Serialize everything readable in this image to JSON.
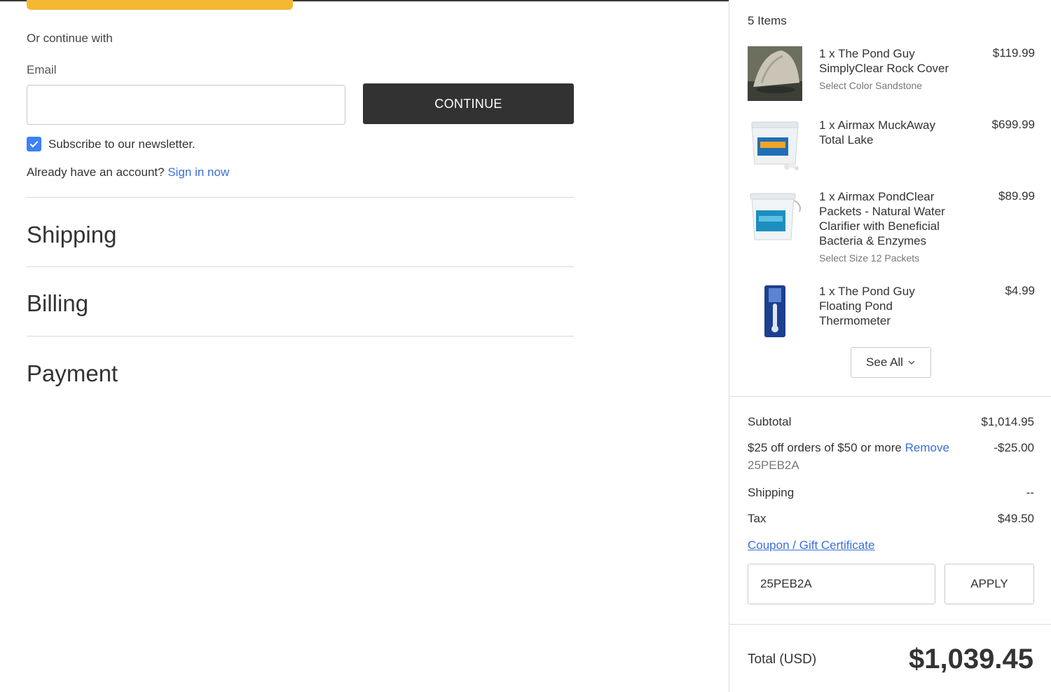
{
  "account": {
    "or_continue": "Or continue with",
    "email_label": "Email",
    "email_value": "",
    "continue_label": "CONTINUE",
    "newsletter_label": "Subscribe to our newsletter.",
    "newsletter_checked": true,
    "have_account": "Already have an account?",
    "sign_in": "Sign in now"
  },
  "sections": {
    "shipping": "Shipping",
    "billing": "Billing",
    "payment": "Payment"
  },
  "cart": {
    "items_count": "5 Items",
    "items": [
      {
        "name": "1 x The Pond Guy SimplyClear Rock Cover",
        "option": "Select Color Sandstone",
        "price": "$119.99",
        "image": "rock-cover-image"
      },
      {
        "name": "1 x Airmax MuckAway Total Lake",
        "option": "",
        "price": "$699.99",
        "image": "muckaway-bucket-image"
      },
      {
        "name": "1 x Airmax PondClear Packets - Natural Water Clarifier with Beneficial Bacteria & Enzymes",
        "option": "Select Size 12 Packets",
        "price": "$89.99",
        "image": "pondclear-bucket-image"
      },
      {
        "name": "1 x The Pond Guy Floating Pond Thermometer",
        "option": "",
        "price": "$4.99",
        "image": "thermometer-image"
      }
    ],
    "see_all": "See All"
  },
  "summary": {
    "subtotal_label": "Subtotal",
    "subtotal": "$1,014.95",
    "discount_label": "$25 off orders of $50 or more",
    "discount_remove": "Remove",
    "discount_code": "25PEB2A",
    "discount": "-$25.00",
    "shipping_label": "Shipping",
    "shipping": "--",
    "tax_label": "Tax",
    "tax": "$49.50",
    "coupon_link": "Coupon / Gift Certificate",
    "coupon_value": "25PEB2A",
    "apply_label": "APPLY",
    "total_label": "Total (USD)",
    "total": "$1,039.45"
  },
  "colors": {
    "accent_yellow": "#f4b731",
    "link_blue": "#3b6fd8",
    "button_dark": "#323232",
    "checkbox_blue": "#3b82f6"
  }
}
